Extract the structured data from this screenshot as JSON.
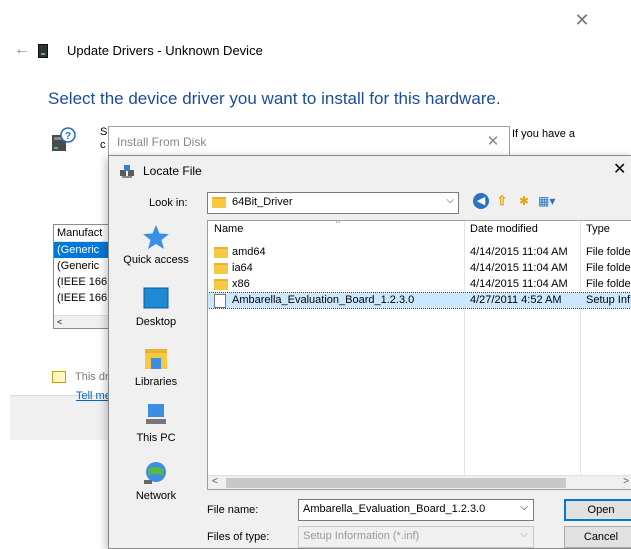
{
  "wizard": {
    "close_glyph": "✕",
    "back_glyph": "←",
    "title": "Update Drivers - Unknown Device",
    "heading": "Select the device driver you want to install for this hardware.",
    "desc_fragment_1": "S",
    "desc_fragment_2": "c",
    "desc_fragment_right": "If you have a",
    "list_header": "Manufact",
    "list_items": [
      "(Generic",
      "(Generic",
      "(IEEE 166",
      "(IEEE 166"
    ],
    "list_scroll_glyph": "<",
    "cert_text": "This dr",
    "link_text": "Tell me"
  },
  "install_from_disk": {
    "title": "Install From Disk",
    "close_glyph": "✕"
  },
  "locate_file": {
    "title": "Locate File",
    "close_glyph": "✕",
    "look_in_label": "Look in:",
    "look_in_value": "64Bit_Driver",
    "dropdown_glyph": "⌵",
    "toolbar": {
      "back_glyph": "◀",
      "up_glyph": "⇧",
      "new_folder_glyph": "✱",
      "view_glyph": "▦▾"
    },
    "places": [
      "Quick access",
      "Desktop",
      "Libraries",
      "This PC",
      "Network"
    ],
    "columns": {
      "name": "Name",
      "date": "Date modified",
      "type": "Type",
      "sort_glyph": "^"
    },
    "files": [
      {
        "name": "amd64",
        "date": "4/14/2015 11:04 AM",
        "type": "File folde"
      },
      {
        "name": "ia64",
        "date": "4/14/2015 11:04 AM",
        "type": "File folde"
      },
      {
        "name": "x86",
        "date": "4/14/2015 11:04 AM",
        "type": "File folde"
      },
      {
        "name": "Ambarella_Evaluation_Board_1.2.3.0",
        "date": "4/27/2011 4:52 AM",
        "type": "Setup Inf"
      }
    ],
    "hscroll": {
      "left_glyph": "<",
      "right_glyph": ">"
    },
    "file_name_label": "File name:",
    "file_name_value": "Ambarella_Evaluation_Board_1.2.3.0",
    "files_of_type_label": "Files of type:",
    "files_of_type_value": "Setup Information (*.inf)",
    "open_label": "Open",
    "cancel_label": "Cancel"
  },
  "colors": {
    "heading_blue": "#1a4c9c",
    "selection_blue": "#0078d7",
    "row_highlight": "#cce8ff",
    "folder_yellow": "#f6c945"
  }
}
